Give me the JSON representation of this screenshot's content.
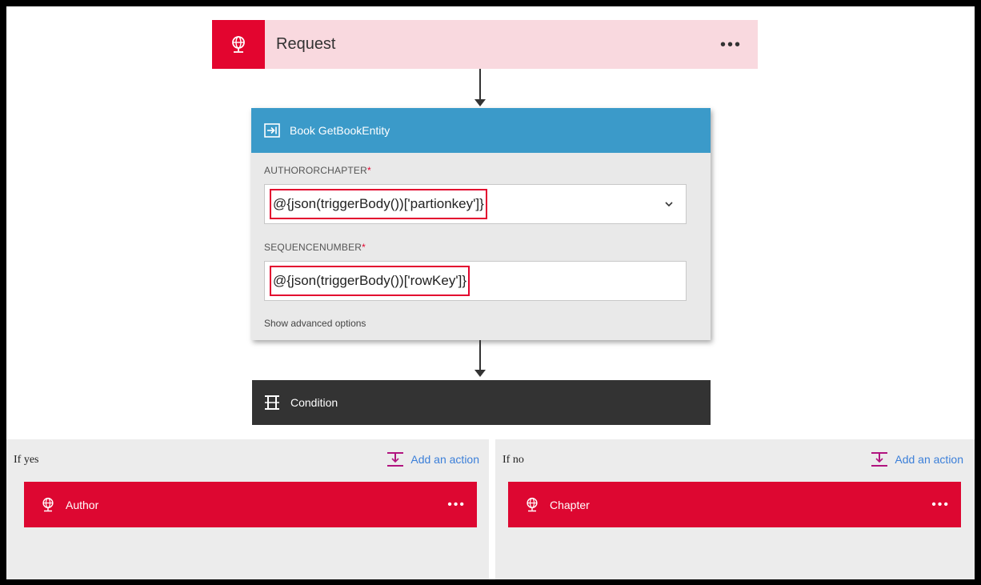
{
  "request": {
    "title": "Request",
    "menu": "•••",
    "icon": "globe-icon"
  },
  "book": {
    "title": "Book GetBookEntity",
    "icon": "api-connection-icon",
    "fields": [
      {
        "label": "AUTHORORCHAPTER",
        "required_mark": "*",
        "value": "@{json(triggerBody())['partionkey']}"
      },
      {
        "label": "SEQUENCENUMBER",
        "required_mark": "*",
        "value": "@{json(triggerBody())['rowKey']}"
      }
    ],
    "advanced_link": "Show advanced options"
  },
  "condition": {
    "title": "Condition",
    "icon": "condition-icon"
  },
  "branches": {
    "yes": {
      "label": "If yes",
      "add_action": "Add an action",
      "action": {
        "title": "Author",
        "menu": "•••"
      }
    },
    "no": {
      "label": "If no",
      "add_action": "Add an action",
      "action": {
        "title": "Chapter",
        "menu": "•••"
      }
    }
  },
  "colors": {
    "accent_red": "#e3052f",
    "request_bg": "#f9d9df",
    "book_header": "#3b9ac9",
    "condition_bg": "#333333",
    "branch_bg": "#ececec",
    "link_blue": "#3b7fd9"
  }
}
